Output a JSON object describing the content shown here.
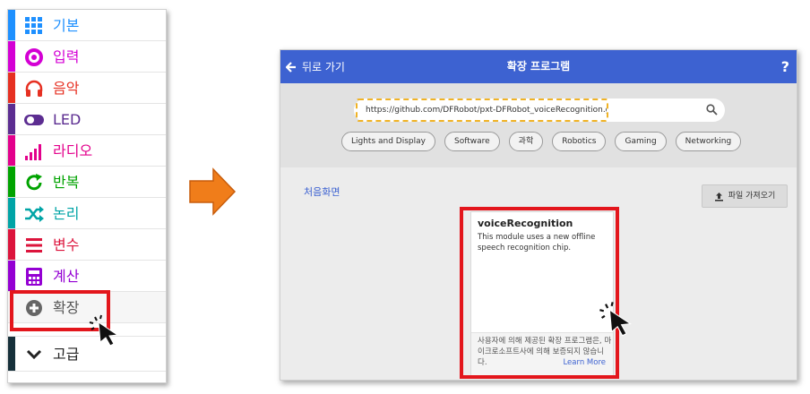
{
  "toolbox": {
    "categories": [
      {
        "label": "기본",
        "color": "#1e90ff",
        "icon": "grid-icon"
      },
      {
        "label": "입력",
        "color": "#d400d4",
        "icon": "radio-target-icon"
      },
      {
        "label": "음악",
        "color": "#e63022",
        "icon": "headphones-icon"
      },
      {
        "label": "LED",
        "color": "#5c2d91",
        "icon": "toggle-icon"
      },
      {
        "label": "라디오",
        "color": "#e3008c",
        "icon": "signal-bars-icon"
      },
      {
        "label": "반복",
        "color": "#00a300",
        "icon": "refresh-icon"
      },
      {
        "label": "논리",
        "color": "#00a4a6",
        "icon": "shuffle-icon"
      },
      {
        "label": "변수",
        "color": "#dc143c",
        "icon": "list-lines-icon"
      },
      {
        "label": "계산",
        "color": "#9400d3",
        "icon": "calculator-icon"
      },
      {
        "label": "확장",
        "color": "#555555",
        "icon": "plus-circle-icon"
      },
      {
        "label": "고급",
        "color": "#222222",
        "icon": "chevron-down-icon"
      }
    ]
  },
  "dialog": {
    "back_label": "뒤로 가기",
    "title": "확장 프로그램",
    "help_label": "?",
    "search_value": "https://github.com/DFRobot/pxt-DFRobot_voiceRecognition.git",
    "chips": [
      "Lights and Display",
      "Software",
      "과학",
      "Robotics",
      "Gaming",
      "Networking"
    ],
    "home_label": "처음화면",
    "import_label": "파일 가져오기",
    "card": {
      "title": "voiceRecognition",
      "description": "This module uses a new offline speech recognition chip.",
      "note": "사용자에 의해 제공된 확장 프로그램은, 마이크로소프트사에 의해 보증되지 않습니다.",
      "learn_more": "Learn More"
    }
  },
  "colors": {
    "header": "#3d62d1",
    "highlight": "#e3161c",
    "arrow": "#f07d1a",
    "search_dash": "#f0b326"
  }
}
